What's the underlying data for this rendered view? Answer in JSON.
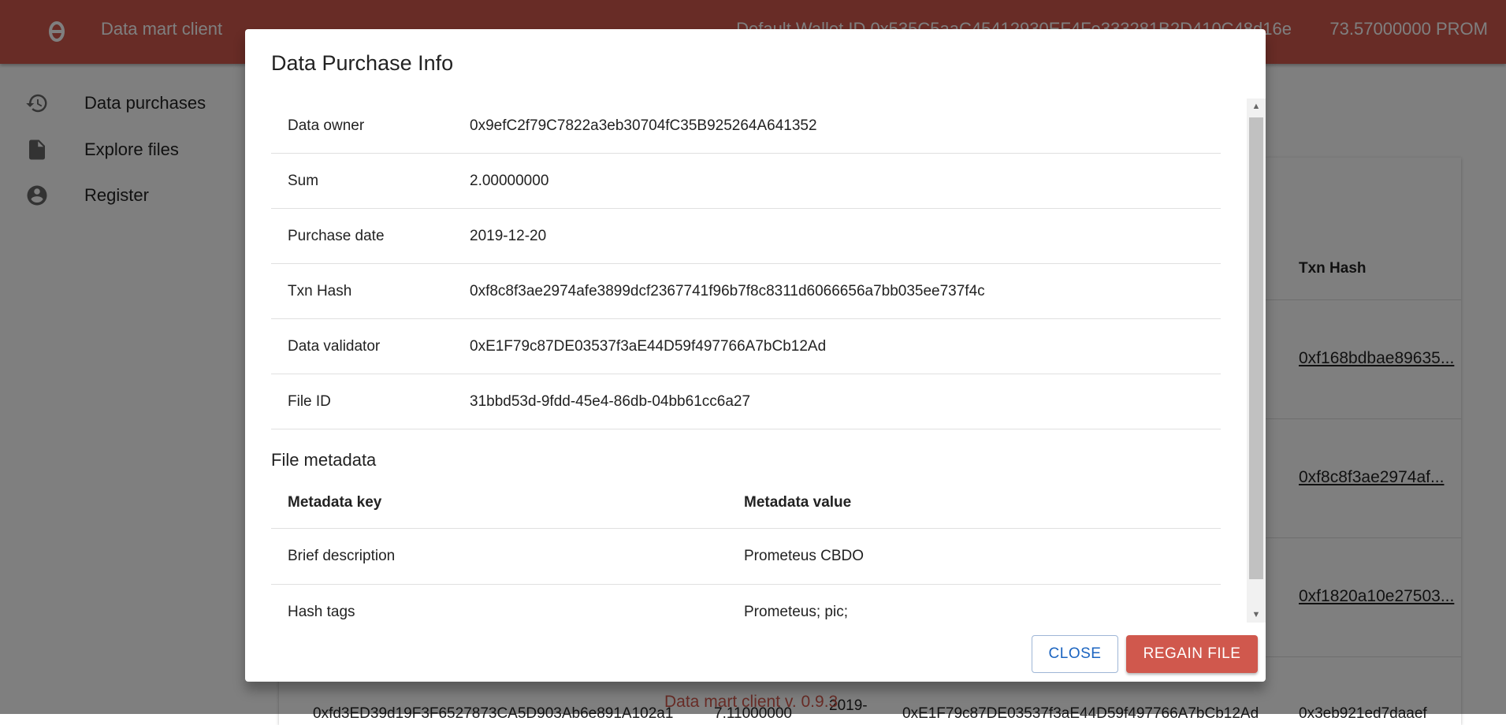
{
  "app": {
    "title": "Data mart client",
    "wallet": "Default Wallet ID 0x535C5aaC45412930EF4Fe333281B2D410C48d16e",
    "balance": "73.57000000 PROM",
    "footer": "Data mart client v. 0.9.3"
  },
  "sidebar": {
    "items": [
      {
        "label": "Data purchases",
        "icon": "history-icon"
      },
      {
        "label": "Explore files",
        "icon": "file-icon"
      },
      {
        "label": "Register",
        "icon": "account-circle-icon"
      }
    ]
  },
  "background": {
    "column_header": "Txn Hash",
    "txn_links": [
      "0xf168bdbae89635...",
      "0xf8c8f3ae2974af...",
      "0xf1820a10e27503..."
    ],
    "bottom_row": [
      "0xfd3ED39d19F3F6527873CA5D903Ab6e891A102a1",
      "7.11000000",
      "2019-",
      "0xE1F79c87DE03537f3aE44D59f497766A7bCb12Ad",
      "0x3eb921ed7daaef"
    ]
  },
  "dialog": {
    "title": "Data Purchase Info",
    "info": [
      {
        "key": "Data owner",
        "value": "0x9efC2f79C7822a3eb30704fC35B925264A641352"
      },
      {
        "key": "Sum",
        "value": "2.00000000"
      },
      {
        "key": "Purchase date",
        "value": "2019-12-20"
      },
      {
        "key": "Txn Hash",
        "value": "0xf8c8f3ae2974afe3899dcf2367741f96b7f8c8311d6066656a7bb035ee737f4c"
      },
      {
        "key": "Data validator",
        "value": "0xE1F79c87DE03537f3aE44D59f497766A7bCb12Ad"
      },
      {
        "key": "File ID",
        "value": "31bbd53d-9fdd-45e4-86db-04bb61cc6a27"
      }
    ],
    "metadata": {
      "heading": "File metadata",
      "key_header": "Metadata key",
      "value_header": "Metadata value",
      "rows": [
        {
          "key": "Brief description",
          "value": "Prometeus CBDO"
        },
        {
          "key": "Hash tags",
          "value": "Prometeus; pic;"
        }
      ]
    },
    "buttons": {
      "close": "Close",
      "regain": "Regain file"
    }
  },
  "colors": {
    "accent": "#d0584d",
    "link_blue": "#1b64c0"
  }
}
